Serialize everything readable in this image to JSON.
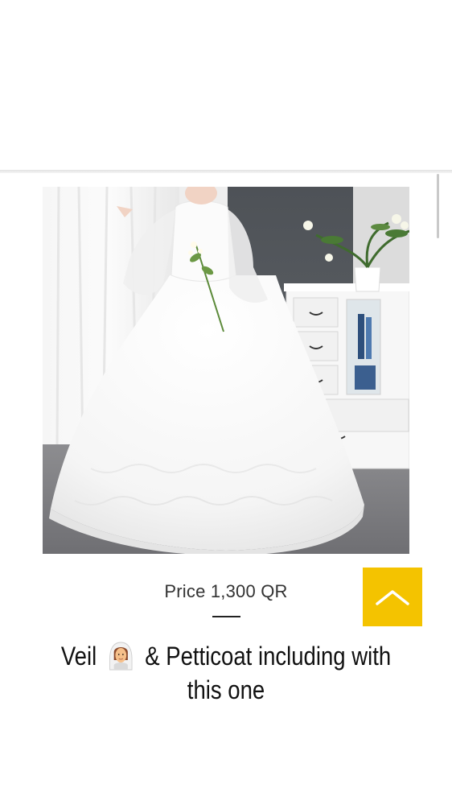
{
  "product": {
    "image_alt": "White long-sleeve lace ball gown wedding dress",
    "price": "Price 1,300 QR"
  },
  "caption": {
    "part1": "Veil",
    "emoji": "bride-with-veil-icon",
    "part2": "& Petticoat  including with",
    "line2": "this one"
  },
  "scroll_top_button": {
    "icon": "chevron-up-icon",
    "color": "#f4c300"
  }
}
